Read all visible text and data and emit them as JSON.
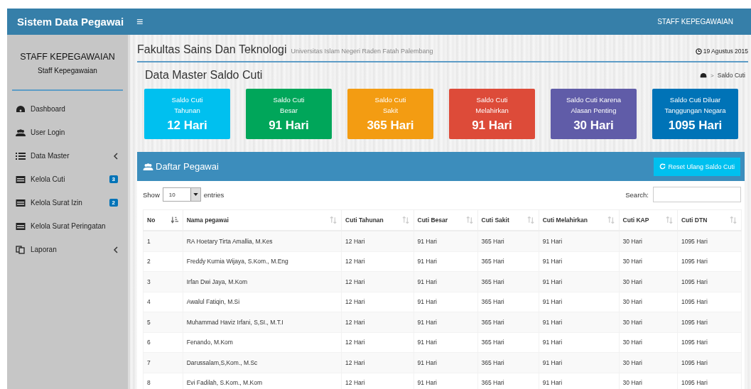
{
  "navbar": {
    "brand": "Sistem Data Pegawai",
    "menu_toggle": "≡",
    "user": "STAFF KEPEGAWAIAN"
  },
  "sidebar": {
    "user_name": "STAFF KEPEGAWAIAN",
    "user_role": "Staff Kepegawaian",
    "items": [
      {
        "label": "Dashboard",
        "has_submenu": false
      },
      {
        "label": "User Login",
        "has_submenu": false
      },
      {
        "label": "Data Master",
        "has_submenu": true
      },
      {
        "label": "Kelola Cuti",
        "badge": "3",
        "has_submenu": false
      },
      {
        "label": "Kelola Surat Izin",
        "badge": "2",
        "has_submenu": false
      },
      {
        "label": "Kelola Surat Peringatan",
        "has_submenu": false
      },
      {
        "label": "Laporan",
        "has_submenu": true
      }
    ]
  },
  "header": {
    "title": "Fakultas Sains Dan Teknologi",
    "subtitle": "Universitas Islam Negeri Raden Fatah Palembang",
    "date": "19 Agustus 2015"
  },
  "page": {
    "title": "Data Master Saldo Cuti",
    "breadcrumb_separator": ">",
    "breadcrumb": "Saldo Cuti"
  },
  "stats": [
    {
      "label": "Saldo Cuti\nTahunan",
      "value": "12 Hari",
      "color": "#00c0ef"
    },
    {
      "label": "Saldo Cuti\nBesar",
      "value": "91 Hari",
      "color": "#00a65a"
    },
    {
      "label": "Saldo Cuti\nSakit",
      "value": "365 Hari",
      "color": "#f39c12"
    },
    {
      "label": "Saldo Cuti\nMelahirkan",
      "value": "91 Hari",
      "color": "#dd4b39"
    },
    {
      "label": "Saldo Cuti Karena\nAlasan Penting",
      "value": "30 Hari",
      "color": "#605ca8"
    },
    {
      "label": "Saldo Cuti Diluar\nTanggungan Negara",
      "value": "1095 Hari",
      "color": "#0073b7"
    }
  ],
  "panel": {
    "title": "Daftar Pegawai",
    "reset_button": "Reset Ulang Saldo Cuti",
    "show_label": "Show",
    "entries_value": "10",
    "entries_label": "entries",
    "search_label": "Search:"
  },
  "table": {
    "columns": [
      {
        "label": "No",
        "sorted": true
      },
      {
        "label": "Nama pegawai",
        "sorted": false
      },
      {
        "label": "Cuti Tahunan",
        "sorted": false
      },
      {
        "label": "Cuti Besar",
        "sorted": false
      },
      {
        "label": "Cuti Sakit",
        "sorted": false
      },
      {
        "label": "Cuti Melahirkan",
        "sorted": false
      },
      {
        "label": "Cuti KAP",
        "sorted": false
      },
      {
        "label": "Cuti DTN",
        "sorted": false
      }
    ],
    "rows": [
      [
        "1",
        "RA Hoetary Tirta Amallia, M.Kes",
        "12 Hari",
        "91 Hari",
        "365 Hari",
        "91 Hari",
        "30 Hari",
        "1095 Hari"
      ],
      [
        "2",
        "Freddy Kurnia Wijaya, S.Kom., M.Eng",
        "12 Hari",
        "91 Hari",
        "365 Hari",
        "91 Hari",
        "30 Hari",
        "1095 Hari"
      ],
      [
        "3",
        "Irfan Dwi Jaya, M.Kom",
        "12 Hari",
        "91 Hari",
        "365 Hari",
        "91 Hari",
        "30 Hari",
        "1095 Hari"
      ],
      [
        "4",
        "Awalul Fatiqin, M.Si",
        "12 Hari",
        "91 Hari",
        "365 Hari",
        "91 Hari",
        "30 Hari",
        "1095 Hari"
      ],
      [
        "5",
        "Muhammad Haviz Irfani, S,SI., M.T.I",
        "12 Hari",
        "91 Hari",
        "365 Hari",
        "91 Hari",
        "30 Hari",
        "1095 Hari"
      ],
      [
        "6",
        "Fenando, M.Kom",
        "12 Hari",
        "91 Hari",
        "365 Hari",
        "91 Hari",
        "30 Hari",
        "1095 Hari"
      ],
      [
        "7",
        "Darussalam,S,Kom., M.Sc",
        "12 Hari",
        "91 Hari",
        "365 Hari",
        "91 Hari",
        "30 Hari",
        "1095 Hari"
      ],
      [
        "8",
        "Evi Fadilah, S.Kom., M.Kom",
        "12 Hari",
        "91 Hari",
        "365 Hari",
        "91 Hari",
        "30 Hari",
        "1095 Hari"
      ]
    ]
  }
}
